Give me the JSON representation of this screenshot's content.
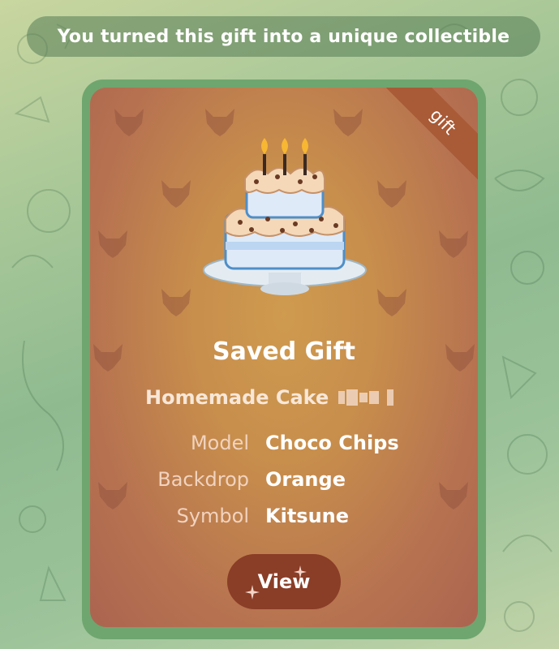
{
  "service_message": "You turned this gift into a unique collectible",
  "card": {
    "ribbon_label": "gift",
    "title": "Saved Gift",
    "subtitle": "Homemade Cake",
    "attributes": [
      {
        "key": "Model",
        "value": "Choco Chips"
      },
      {
        "key": "Backdrop",
        "value": "Orange"
      },
      {
        "key": "Symbol",
        "value": "Kitsune"
      }
    ],
    "button_label": "View"
  },
  "colors": {
    "backdrop": "#c78d4c",
    "ribbon": "#a95a36",
    "button": "#8a3d27",
    "bubble_border": "#6fa66f"
  }
}
